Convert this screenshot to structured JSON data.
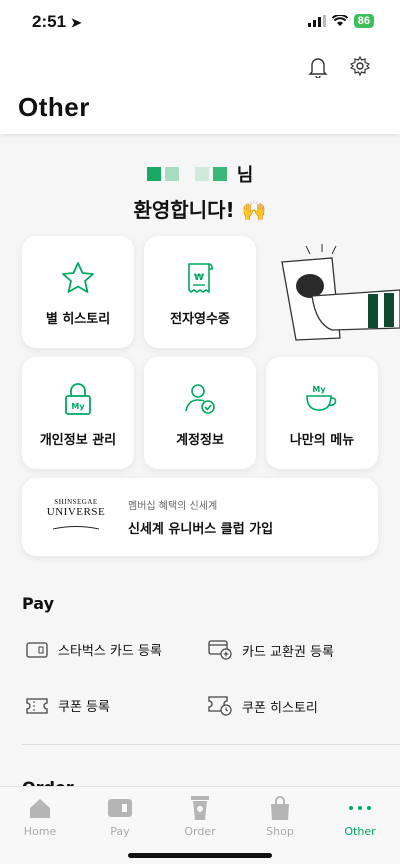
{
  "status": {
    "time": "2:51",
    "battery": "86"
  },
  "header": {
    "title": "Other"
  },
  "welcome": {
    "name_suffix": "님",
    "message": "환영합니다! 🙌"
  },
  "tiles": [
    {
      "label": "별 히스토리",
      "icon": "star-icon"
    },
    {
      "label": "전자영수증",
      "icon": "receipt-icon"
    },
    {
      "label": "개인정보 관리",
      "icon": "lock-icon"
    },
    {
      "label": "계정정보",
      "icon": "account-icon"
    },
    {
      "label": "나만의 메뉴",
      "icon": "cup-icon"
    }
  ],
  "universe": {
    "logo_top": "SHINSEGAE",
    "logo_bottom": "UNIVERSE",
    "subtitle": "멤버십 혜택의 신세계",
    "title": "신세계 유니버스 클럽 가입"
  },
  "pay": {
    "title": "Pay",
    "items": [
      "스타벅스 카드 등록",
      "카드 교환권 등록",
      "쿠폰 등록",
      "쿠폰 히스토리"
    ]
  },
  "order": {
    "title": "Order"
  },
  "tabs": [
    "Home",
    "Pay",
    "Order",
    "Shop",
    "Other"
  ],
  "colors": {
    "accent": "#00a862"
  }
}
